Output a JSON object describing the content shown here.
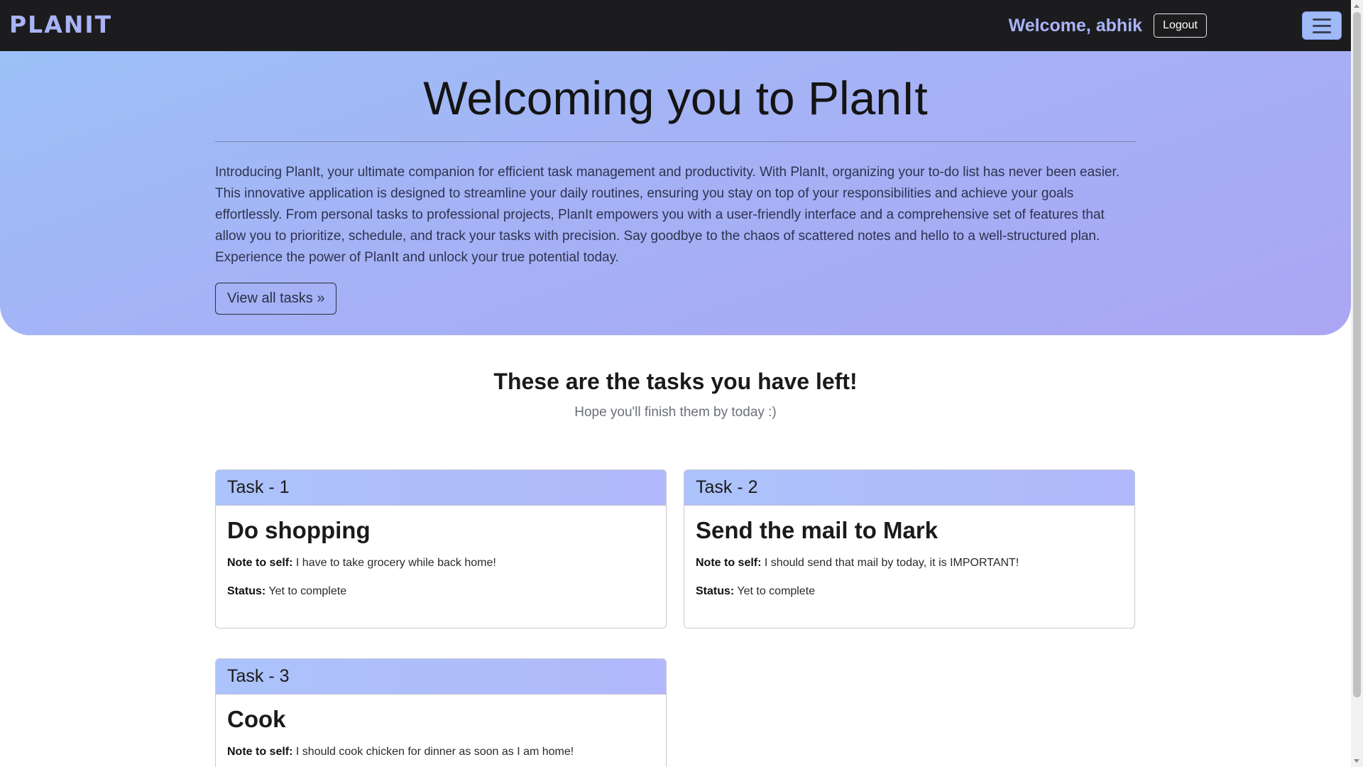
{
  "navbar": {
    "brand": "PLANIT",
    "welcome": "Welcome, abhik",
    "logout_label": "Logout",
    "menu_icon": "hamburger-icon"
  },
  "hero": {
    "title": "Welcoming you to PlanIt",
    "text": "Introducing PlanIt, your ultimate companion for efficient task management and productivity. With PlanIt, organizing your to-do list has never been easier. This innovative application is designed to streamline your daily routines, ensuring you stay on top of your responsibilities and achieve your goals effortlessly. From personal tasks to professional projects, PlanIt empowers you with a user-friendly interface and a comprehensive set of features that allow you to prioritize, schedule, and track your tasks with precision. Say goodbye to the chaos of scattered notes and hello to a well-structured plan. Experience the power of PlanIt and unlock your true potential today.",
    "view_all_label": "View all tasks »"
  },
  "tasks_section": {
    "heading": "These are the tasks you have left!",
    "subheading": "Hope you'll finish them by today :)",
    "note_label": "Note to self:",
    "status_label": "Status:",
    "tasks": [
      {
        "header": "Task - 1",
        "title": "Do shopping",
        "note": "I have to take grocery while back home!",
        "status": "Yet to complete"
      },
      {
        "header": "Task - 2",
        "title": "Send the mail to Mark",
        "note": "I should send that mail by today, it is IMPORTANT!",
        "status": "Yet to complete"
      },
      {
        "header": "Task - 3",
        "title": "Cook",
        "note": "I should cook chicken for dinner as soon as I am home!",
        "status": ""
      }
    ]
  },
  "colors": {
    "navbar_bg": "#1c1c1e",
    "brand": "#a9b3f7",
    "hero_gradient_start": "#9cc0f8",
    "hero_gradient_end": "#aaa6f3",
    "card_header": "#acc3fb"
  }
}
